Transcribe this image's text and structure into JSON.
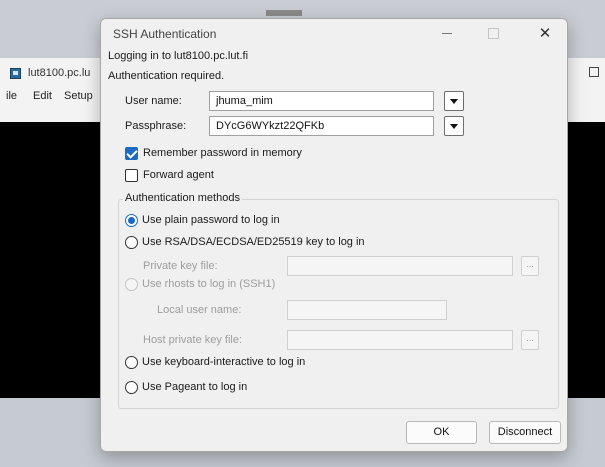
{
  "background_window": {
    "title": "lut8100.pc.lu",
    "menu": [
      "ile",
      "Edit",
      "Setup"
    ]
  },
  "dialog": {
    "title": "SSH Authentication",
    "logging_in": "Logging in to lut8100.pc.lut.fi",
    "auth_required": "Authentication required.",
    "username_label": "User name:",
    "username_value": "jhuma_mim",
    "passphrase_label": "Passphrase:",
    "passphrase_value": "DYcG6WYkzt22QFKb",
    "remember_label": "Remember password in memory",
    "remember_checked": true,
    "forward_label": "Forward agent",
    "forward_checked": false,
    "methods_title": "Authentication methods",
    "methods": {
      "plain": "Use plain password to log in",
      "rsa": "Use RSA/DSA/ECDSA/ED25519 key to log in",
      "private_key_label": "Private key file:",
      "private_key_browse": "...",
      "rhosts": "Use rhosts to log in (SSH1)",
      "local_user_label": "Local user name:",
      "host_key_label": "Host private key file:",
      "host_key_browse": "...",
      "keyboard": "Use keyboard-interactive to log in",
      "pageant": "Use Pageant to log in"
    },
    "selected_method": "plain",
    "ok_label": "OK",
    "disconnect_label": "Disconnect"
  }
}
